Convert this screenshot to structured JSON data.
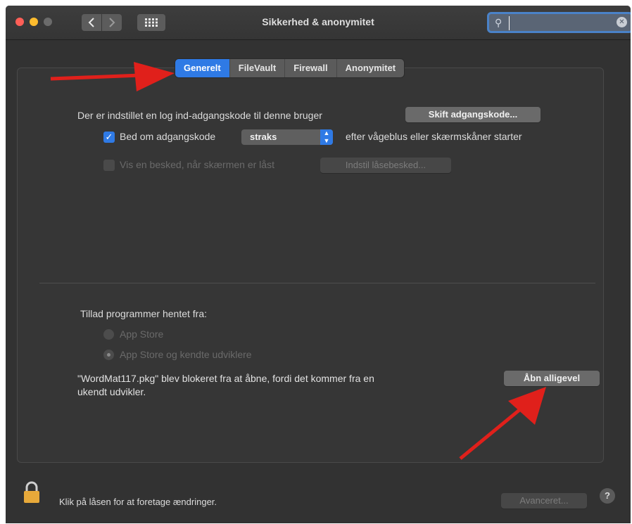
{
  "window": {
    "title": "Sikkerhed & anonymitet",
    "search_placeholder": ""
  },
  "tabs": [
    {
      "label": "Generelt",
      "active": true
    },
    {
      "label": "FileVault",
      "active": false
    },
    {
      "label": "Firewall",
      "active": false
    },
    {
      "label": "Anonymitet",
      "active": false
    }
  ],
  "general": {
    "password_set_text": "Der er indstillet en log ind-adgangskode til denne bruger",
    "change_password_button": "Skift adgangskode...",
    "require_password_label": "Bed om adgangskode",
    "require_password_checked": true,
    "require_password_delay": "straks",
    "require_password_suffix": "efter vågeblus eller skærmskåner starter",
    "show_message_label": "Vis en besked, når skærmen er låst",
    "show_message_checked": false,
    "set_lock_message_button": "Indstil låsebesked..."
  },
  "allow_apps": {
    "heading": "Tillad programmer hentet fra:",
    "option_app_store": "App Store",
    "option_app_store_identified": "App Store og kendte udviklere",
    "selected": "App Store og kendte udviklere",
    "blocked_message_line1": "\"WordMat117.pkg\" blev blokeret fra at åbne, fordi det kommer fra en",
    "blocked_message_line2": "ukendt udvikler.",
    "open_anyway_button": "Åbn alligevel"
  },
  "footer": {
    "lock_text": "Klik på låsen for at foretage ændringer.",
    "advanced_button": "Avanceret...",
    "help_label": "?"
  },
  "colors": {
    "accent": "#2f7ae5",
    "annotation_arrow": "#e0201b",
    "lock": "#e7a93a"
  }
}
